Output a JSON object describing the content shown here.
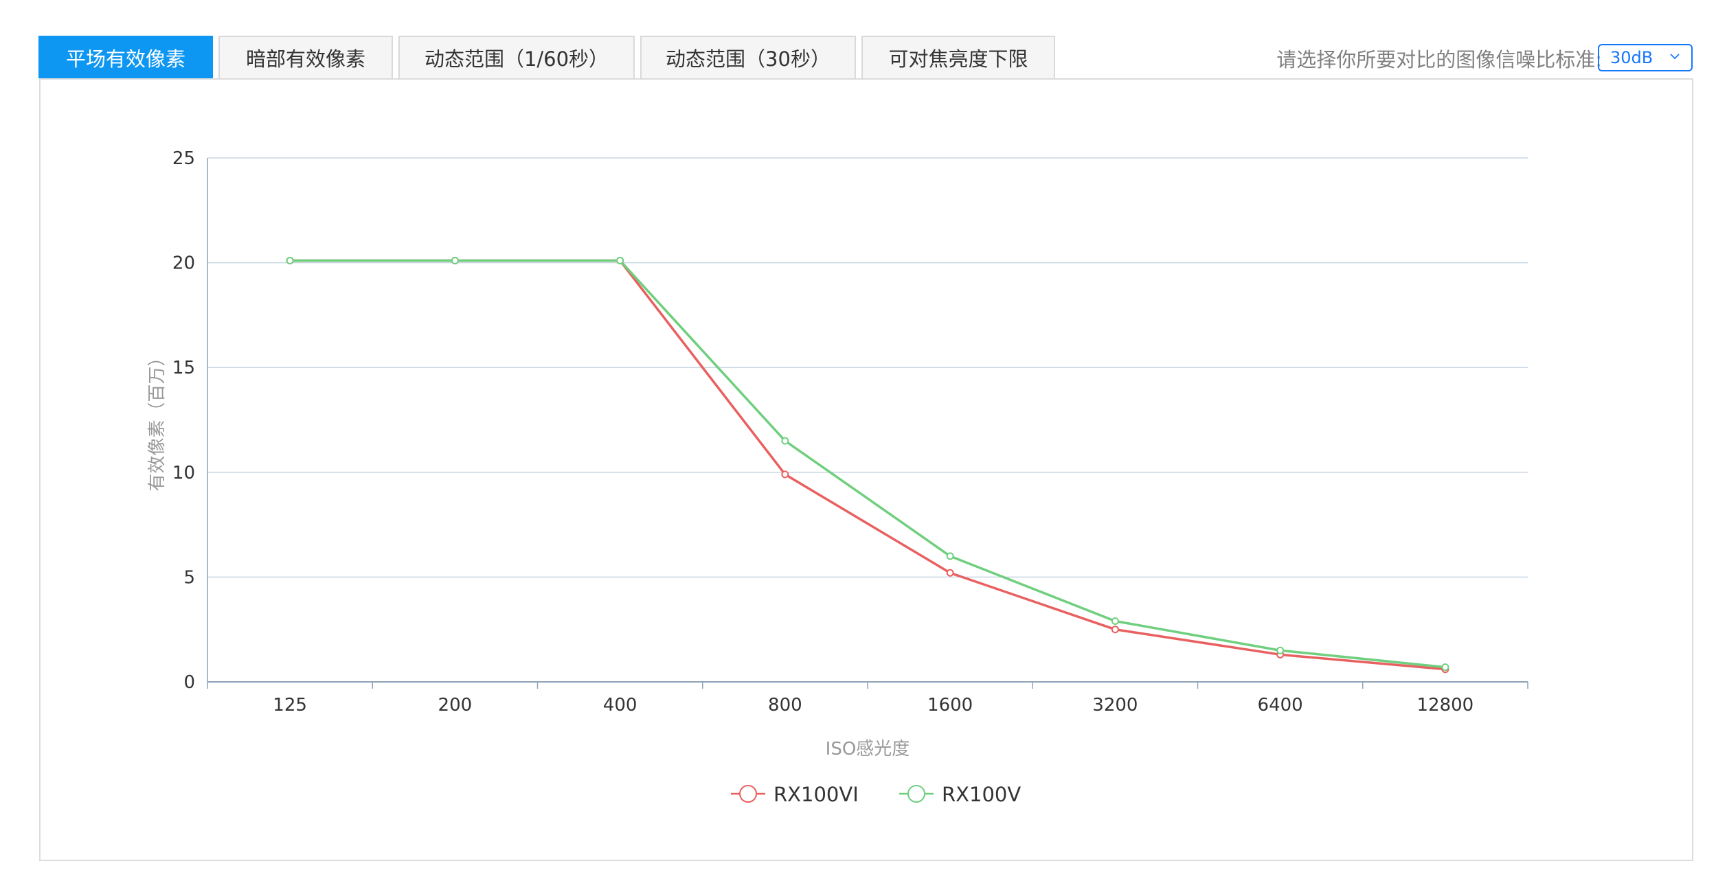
{
  "tabs": [
    {
      "label": "平场有效像素",
      "active": true
    },
    {
      "label": "暗部有效像素",
      "active": false
    },
    {
      "label": "动态范围（1/60秒）",
      "active": false
    },
    {
      "label": "动态范围（30秒）",
      "active": false
    },
    {
      "label": "可对焦亮度下限",
      "active": false
    }
  ],
  "standard": {
    "label": "请选择你所要对比的图像信噪比标准:",
    "selected": "30dB"
  },
  "colors": {
    "accent": "#0d96f2",
    "grid": "#c8d6e3",
    "axis": "#8fa3b8"
  },
  "chart_data": {
    "type": "line",
    "categories": [
      "125",
      "200",
      "400",
      "800",
      "1600",
      "3200",
      "6400",
      "12800"
    ],
    "xlabel": "ISO感光度",
    "ylabel": "有效像素（百万）",
    "ylim": [
      0,
      25
    ],
    "yticks": [
      0,
      5,
      10,
      15,
      20,
      25
    ],
    "grid": true,
    "legend": "bottom-center",
    "series": [
      {
        "name": "RX100VI",
        "color": "#e8605f",
        "values": [
          20.1,
          20.1,
          20.1,
          9.9,
          5.2,
          2.5,
          1.3,
          0.6
        ]
      },
      {
        "name": "RX100V",
        "color": "#6fcf7f",
        "values": [
          20.1,
          20.1,
          20.1,
          11.5,
          6.0,
          2.9,
          1.5,
          0.7
        ]
      }
    ]
  }
}
